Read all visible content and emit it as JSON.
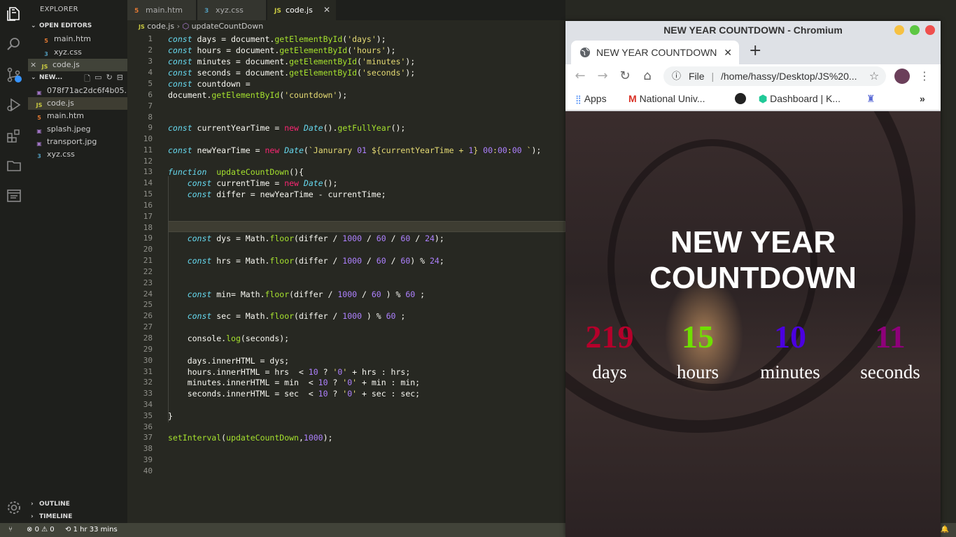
{
  "sidebar": {
    "title": "EXPLORER",
    "open_editors_label": "OPEN EDITORS",
    "open_editors": [
      "main.htm",
      "xyz.css",
      "code.js"
    ],
    "folder_label": "NEW...",
    "files": [
      "078f71ac2dc6f4b05...",
      "code.js",
      "main.htm",
      "splash.jpeg",
      "transport.jpg",
      "xyz.css"
    ],
    "outline_label": "OUTLINE",
    "timeline_label": "TIMELINE"
  },
  "tabs": [
    {
      "label": "main.htm",
      "type": "htm"
    },
    {
      "label": "xyz.css",
      "type": "css"
    },
    {
      "label": "code.js",
      "type": "js"
    }
  ],
  "breadcrumb": {
    "file": "code.js",
    "symbol": "updateCountDown"
  },
  "editor": {
    "line_count": 40,
    "lines": [
      "const days = document.getElementById('days');",
      "const hours = document.getElementById('hours');",
      "const minutes = document.getElementById('minutes');",
      "const seconds = document.getElementById('seconds');",
      "const countdown =",
      "document.getElementById('countdown');",
      "",
      "",
      "const currentYearTime = new Date().getFullYear();",
      "",
      "const newYearTime = new Date(`Janurary 01 ${currentYearTime + 1} 00:00:00 `);",
      "",
      "function  updateCountDown(){",
      "    const currentTime = new Date();",
      "    const differ = newYearTime - currentTime;",
      "",
      "",
      "",
      "    const dys = Math.floor(differ / 1000 / 60 / 60 / 24);",
      "",
      "    const hrs = Math.floor(differ / 1000 / 60 / 60) % 24;",
      "",
      "",
      "    const min= Math.floor(differ / 1000 / 60 ) % 60 ;",
      "",
      "    const sec = Math.floor(differ / 1000 ) % 60 ;",
      "",
      "    console.log(seconds);",
      "",
      "    days.innerHTML = dys;",
      "    hours.innerHTML = hrs  < 10 ? '0' + hrs : hrs;",
      "    minutes.innerHTML = min  < 10 ? '0' + min : min;",
      "    seconds.innerHTML = sec  < 10 ? '0' + sec : sec;",
      "",
      "}",
      "",
      "setInterval(updateCountDown,1000);",
      "",
      "",
      ""
    ]
  },
  "statusbar": {
    "errors": "0",
    "warnings": "0",
    "time": "1 hr 33 mins"
  },
  "browser": {
    "window_title": "NEW YEAR COUNTDOWN - Chromium",
    "tab_title": "NEW YEAR COUNTDOWN",
    "url_scheme": "File",
    "url": "/home/hassy/Desktop/JS%20...",
    "bookmarks": [
      "Apps",
      "National Univ...",
      "Dashboard | K..."
    ],
    "overflow": "»"
  },
  "page": {
    "title_line1": "NEW YEAR",
    "title_line2": "COUNTDOWN",
    "days": "219",
    "days_label": "days",
    "hours": "15",
    "hours_label": "hours",
    "minutes": "10",
    "minutes_label": "minutes",
    "seconds": "11",
    "seconds_label": "seconds",
    "colors": {
      "days": "#b5002b",
      "hours": "#6fe000",
      "minutes": "#4b00e0",
      "seconds": "#8e007a"
    }
  }
}
